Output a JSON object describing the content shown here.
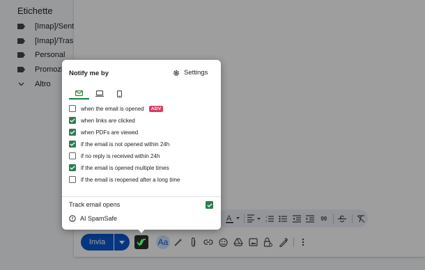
{
  "sidebar": {
    "title": "Etichette",
    "labels": [
      {
        "label": "[Imap]/Sent"
      },
      {
        "label": "[Imap]/Trash"
      },
      {
        "label": "Personal"
      },
      {
        "label": "Promozioni"
      }
    ],
    "more_label": "Altro"
  },
  "popup": {
    "title": "Notify me by",
    "settings_label": "Settings",
    "tabs": [
      {
        "icon": "mail-icon",
        "active": true
      },
      {
        "icon": "laptop-icon",
        "active": false
      },
      {
        "icon": "phone-icon",
        "active": false
      }
    ],
    "options": [
      {
        "label": "when the email is opened",
        "checked": false,
        "badge": "ADV"
      },
      {
        "label": "when links are clicked",
        "checked": true
      },
      {
        "label": "when PDFs are viewed",
        "checked": true
      },
      {
        "label": "if the email is not opened within 24h",
        "checked": true
      },
      {
        "label": "if no reply is received within 24h",
        "checked": false
      },
      {
        "label": "if the email is opened multiple times",
        "checked": true
      },
      {
        "label": "if the email is reopened after a long time",
        "checked": false
      }
    ],
    "track_label": "Track email opens",
    "track_checked": true,
    "spam_label": "AI SpamSafe"
  },
  "compose": {
    "send_label": "Invia",
    "format_icons": [
      "text-color-icon",
      "align-icon",
      "numbered-list-icon",
      "bulleted-list-icon",
      "indent-less-icon",
      "indent-more-icon",
      "quote-icon",
      "strikethrough-icon",
      "clear-formatting-icon"
    ],
    "bottom_icons": [
      "formatting-icon",
      "ai-pen-icon",
      "attach-icon",
      "link-icon",
      "emoji-icon",
      "drive-icon",
      "photo-icon",
      "lock-icon",
      "signature-icon",
      "more-options-icon"
    ],
    "formatting_label": "Aa",
    "quote_label": "99"
  },
  "colors": {
    "accent_green": "#2e7d4f",
    "send_blue": "#0b57d0",
    "adv_badge": "#d93a62"
  }
}
